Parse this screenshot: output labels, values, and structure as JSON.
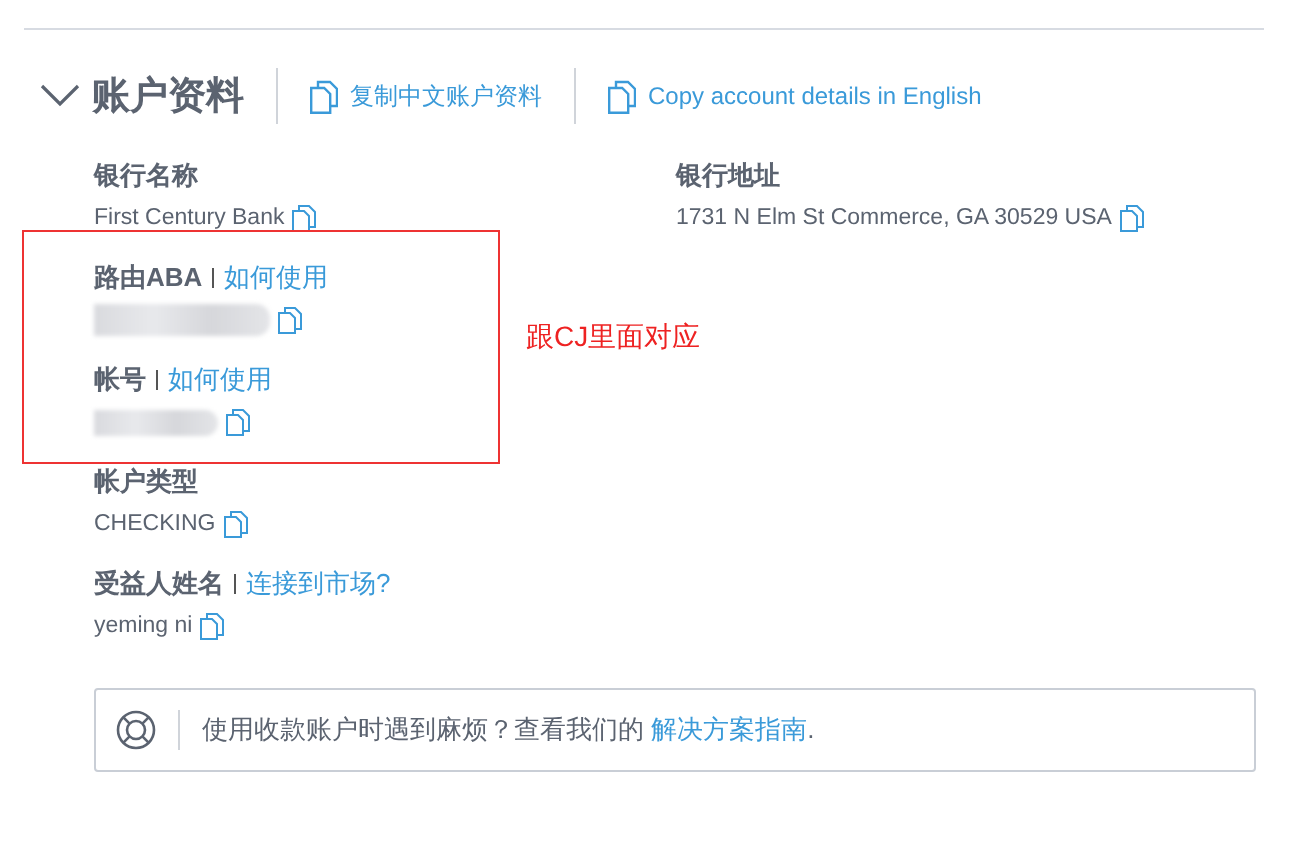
{
  "section": {
    "title": "账户资料",
    "expanded": true,
    "actions": [
      {
        "label": "复制中文账户资料"
      },
      {
        "label": "Copy account details in English"
      }
    ]
  },
  "field_columns": [
    [
      {
        "label": "银行名称",
        "kind": "text",
        "value": "First Century Bank"
      },
      {
        "label": "路由ABA",
        "link": "如何使用",
        "kind": "masked"
      },
      {
        "label": "帐号",
        "link": "如何使用",
        "kind": "masked"
      },
      {
        "label": "帐户类型",
        "kind": "text",
        "value": "CHECKING"
      },
      {
        "label": "受益人姓名",
        "link": "连接到市场?",
        "kind": "text",
        "value": "yeming ni"
      }
    ],
    [
      {
        "label": "银行地址",
        "kind": "text",
        "value": "1731 N Elm St Commerce, GA 30529 USA"
      }
    ]
  ],
  "annotation": {
    "text": "跟CJ里面对应"
  },
  "help": {
    "text": "使用收款账户时遇到麻烦？查看我们的",
    "link": "解决方案指南",
    "suffix": "."
  }
}
